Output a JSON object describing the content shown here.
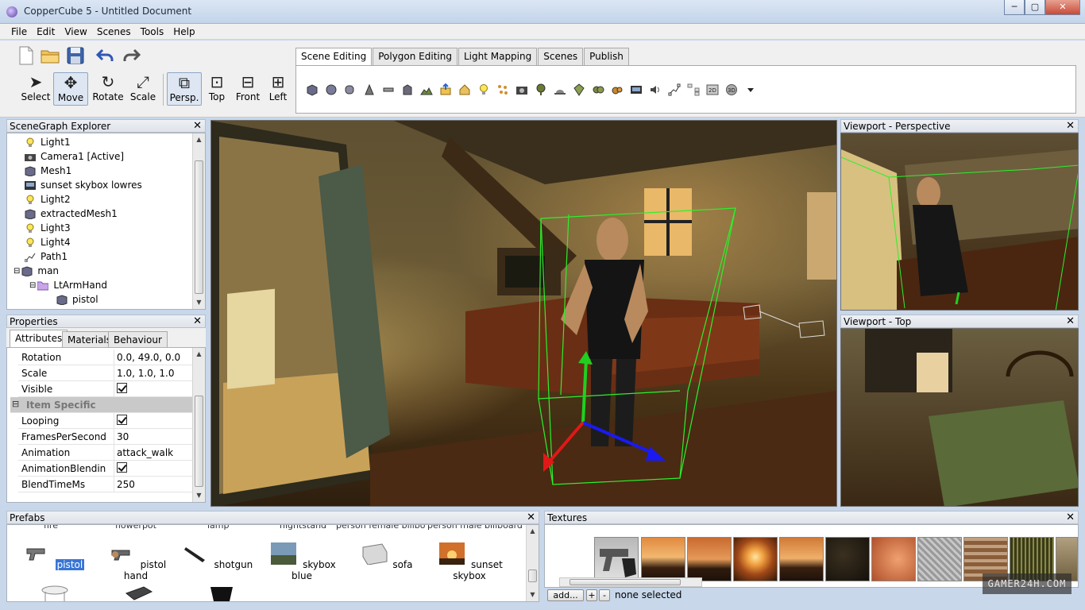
{
  "window": {
    "title": "CopperCube 5 - Untitled Document",
    "min_label": "─",
    "max_label": "▢",
    "close_label": "✕"
  },
  "menu": [
    "File",
    "Edit",
    "View",
    "Scenes",
    "Tools",
    "Help"
  ],
  "tools": [
    "Select",
    "Move",
    "Rotate",
    "Scale"
  ],
  "views": [
    "Persp.",
    "Top",
    "Front",
    "Left"
  ],
  "tabs": [
    "Scene Editing",
    "Polygon Editing",
    "Light Mapping",
    "Scenes",
    "Publish"
  ],
  "scenegraph": {
    "title": "SceneGraph Explorer",
    "items": [
      "Light1",
      "Camera1 [Active]",
      "Mesh1",
      "sunset skybox lowres",
      "Light2",
      "extractedMesh1",
      "Light3",
      "Light4",
      "Path1",
      "man",
      "LtArmHand",
      "pistol"
    ]
  },
  "properties": {
    "title": "Properties",
    "tabs": [
      "Attributes",
      "Materials",
      "Behaviour"
    ],
    "rows": [
      {
        "name": "Rotation",
        "value": "0.0, 49.0, 0.0"
      },
      {
        "name": "Scale",
        "value": "1.0, 1.0, 1.0"
      },
      {
        "name": "Visible",
        "value": ""
      },
      {
        "name": "Item Specific",
        "value": ""
      },
      {
        "name": "Looping",
        "value": ""
      },
      {
        "name": "FramesPerSecond",
        "value": "30"
      },
      {
        "name": "Animation",
        "value": "attack_walk"
      },
      {
        "name": "AnimationBlendin",
        "value": ""
      },
      {
        "name": "BlendTimeMs",
        "value": "250"
      }
    ]
  },
  "viewports": {
    "perspective": "Viewport - Perspective",
    "top": "Viewport - Top"
  },
  "prefabs": {
    "title": "Prefabs",
    "top_row": [
      "fire",
      "flowerpot",
      "lamp",
      "nightstand",
      "person female billbo",
      "person male billboard"
    ],
    "items": [
      "pistol",
      "pistol hand",
      "shotgun",
      "skybox blue",
      "sofa",
      "sunset skybox"
    ]
  },
  "textures": {
    "title": "Textures",
    "add_label": "add...",
    "plus_label": "+",
    "minus_label": "-",
    "status": "none selected"
  },
  "watermark": "GAMER24H.COM",
  "close_glyph": "✕",
  "tree_glyphs": {
    "minus": "⊟"
  }
}
